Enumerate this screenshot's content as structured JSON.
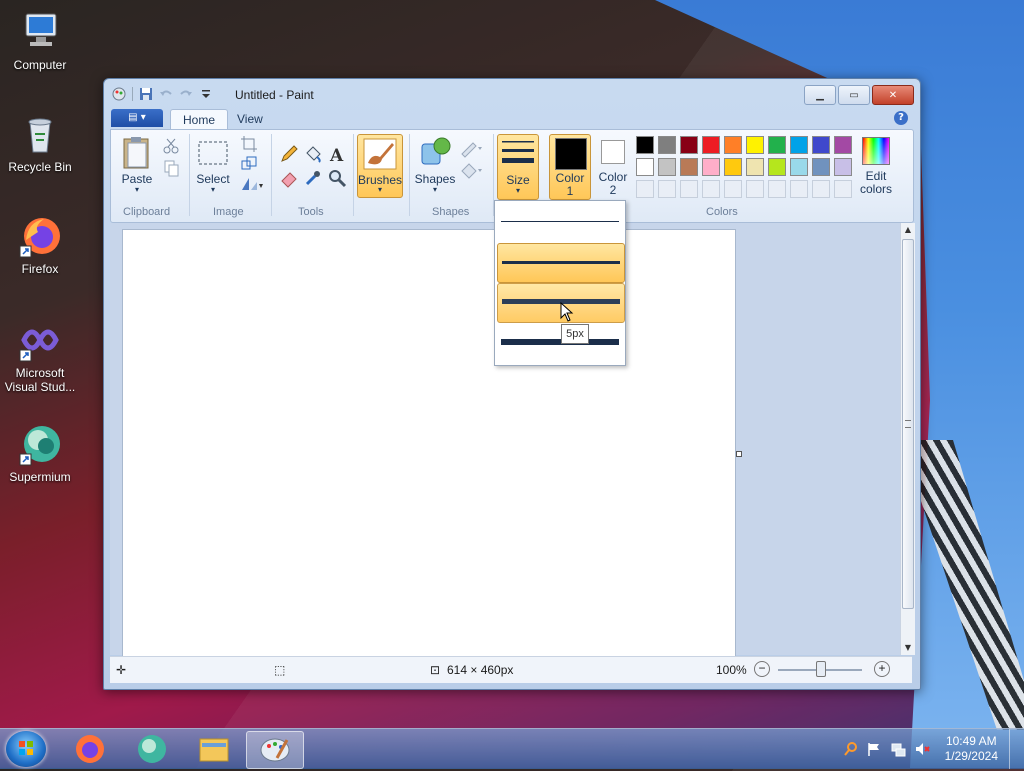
{
  "desktop": {
    "icons": [
      {
        "label": "Computer"
      },
      {
        "label": "Recycle Bin"
      },
      {
        "label": "Firefox"
      },
      {
        "label": "Microsoft Visual Stud..."
      },
      {
        "label": "Supermium"
      }
    ]
  },
  "window": {
    "title": "Untitled - Paint",
    "tabs": [
      "Home",
      "View"
    ],
    "help": "?"
  },
  "ribbon": {
    "clipboard": {
      "paste_label": "Paste",
      "group_label": "Clipboard"
    },
    "image": {
      "select_label": "Select",
      "group_label": "Image"
    },
    "tools": {
      "group_label": "Tools"
    },
    "brushes": {
      "label": "Brushes"
    },
    "shapes": {
      "label": "Shapes",
      "group_label": "Shapes"
    },
    "size": {
      "label": "Size"
    },
    "color1": {
      "label_line1": "Color",
      "label_line2": "1",
      "value": "#000000"
    },
    "color2": {
      "label_line1": "Color",
      "label_line2": "2",
      "value": "#ffffff"
    },
    "colors": {
      "group_label": "Colors",
      "edit_line1": "Edit",
      "edit_line2": "colors",
      "row1": [
        "#000000",
        "#7f7f7f",
        "#880015",
        "#ed1c24",
        "#ff7f27",
        "#fff200",
        "#22b14c",
        "#00a2e8",
        "#3f48cc",
        "#a349a4"
      ],
      "row2": [
        "#ffffff",
        "#c3c3c3",
        "#b97a57",
        "#ffaec9",
        "#ffc90e",
        "#efe4b0",
        "#b5e61d",
        "#99d9ea",
        "#7092be",
        "#c8bfe7"
      ]
    }
  },
  "size_dropdown": {
    "options": [
      {
        "thickness": 1,
        "state": "normal"
      },
      {
        "thickness": 3,
        "state": "selected"
      },
      {
        "thickness": 5,
        "state": "hover"
      },
      {
        "thickness": 8,
        "state": "normal"
      }
    ],
    "tooltip": "5px"
  },
  "statusbar": {
    "dimensions": "614 × 460px",
    "zoom": "100%"
  },
  "taskbar": {
    "time": "10:49 AM",
    "date": "1/29/2024"
  }
}
